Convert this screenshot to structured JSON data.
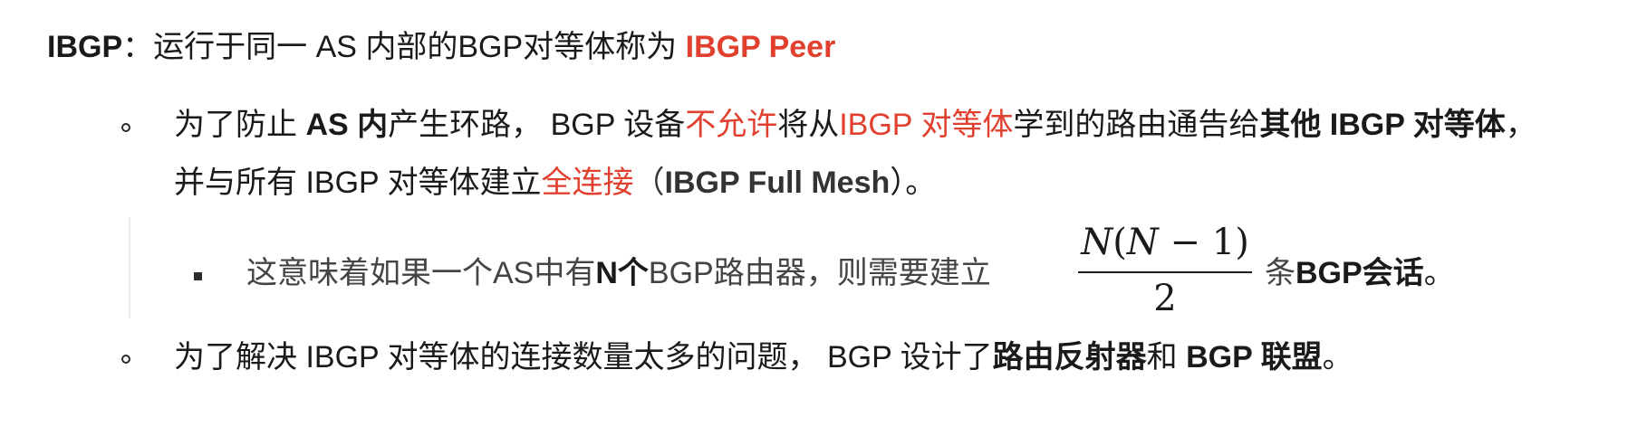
{
  "title": {
    "prefix": "IBGP",
    "colon": "：",
    "text": "运行于同一 AS 内部的BGP对等体称为 ",
    "highlight": "IBGP Peer"
  },
  "item1": {
    "line1": {
      "t1": "为了防止 ",
      "b1": "AS 内",
      "t2": "产生环路，  BGP 设备",
      "r1": "不允许",
      "t3": "将从",
      "r2": "IBGP 对等体",
      "t4": "学到的路由通告给",
      "b2": "其他 IBGP 对等体",
      "t5": "，"
    },
    "line2": {
      "t1": "并与所有 IBGP 对等体建立",
      "r1": "全连接",
      "t2": "（",
      "b1": "IBGP Full Mesh",
      "t3": "）。"
    }
  },
  "sub_item": {
    "t1": "这意味着如果一个AS中有",
    "b1": "N个",
    "t2": "BGP路由器，则需要建立",
    "formula": {
      "numerator_n": "N",
      "numerator_open": "(",
      "numerator_n2": "N",
      "numerator_rest": " − 1)",
      "denominator": "2"
    },
    "t3": "条",
    "b2": "BGP会话",
    "t4": "。"
  },
  "item2": {
    "t1": "为了解决 IBGP 对等体的连接数量太多的问题，  BGP 设计了",
    "b1": "路由反射器",
    "t2": "和 ",
    "b2": "BGP 联盟",
    "t3": "。"
  },
  "colors": {
    "text": "#1a1a1a",
    "highlight": "#e0402d"
  }
}
